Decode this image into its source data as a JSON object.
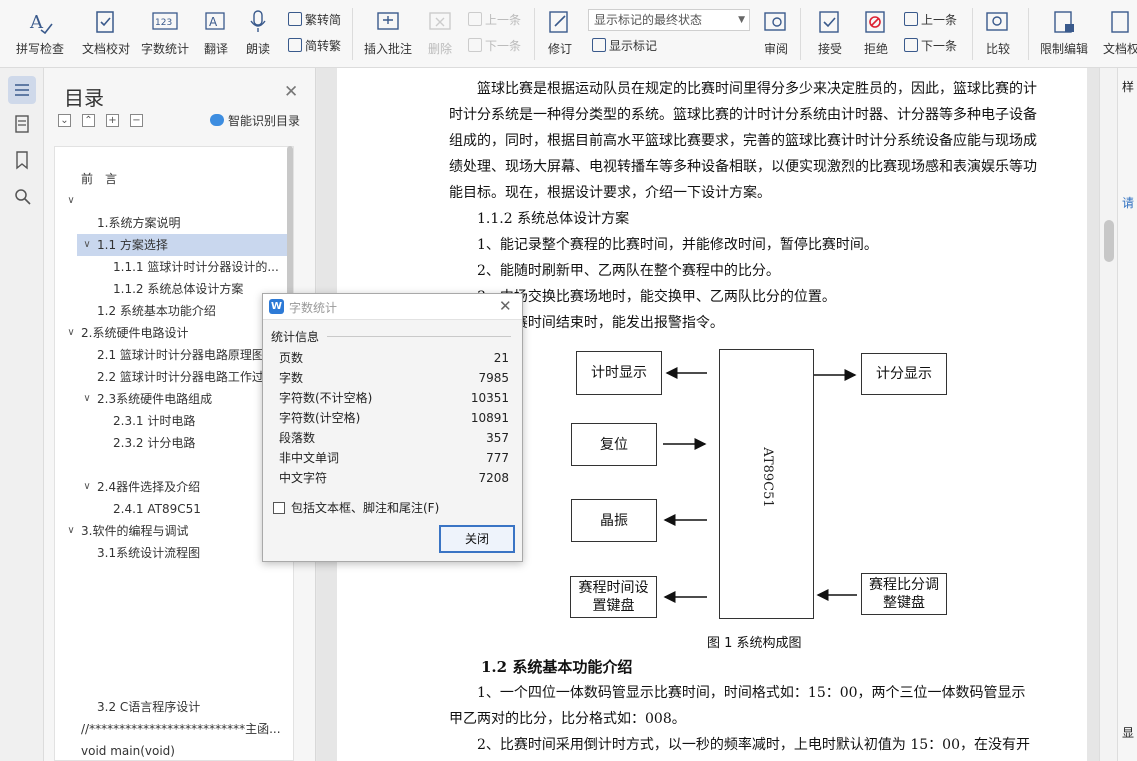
{
  "toolbar": {
    "spell_check": "拼写检查",
    "proofread": "文档校对",
    "word_count": "字数统计",
    "translate": "翻译",
    "read_aloud": "朗读",
    "trad_convert": "繁转简",
    "simp_convert": "简转繁",
    "insert_comment": "插入批注",
    "delete": "删除",
    "prev_comment": "上一条",
    "next_comment": "下一条",
    "revise": "修订",
    "mark_state": "显示标记的最终状态",
    "show_marks": "显示标记",
    "review": "审阅",
    "accept": "接受",
    "reject": "拒绝",
    "prev_change": "上一条",
    "next_change": "下一条",
    "compare": "比较",
    "restrict_edit": "限制编辑",
    "doc_permission": "文档权"
  },
  "toc": {
    "title": "目录",
    "smart_button": "智能识别目录",
    "items": [
      {
        "label": "前　言"
      },
      {
        "label": "1.系统方案说明"
      },
      {
        "label": "1.1  方案选择"
      },
      {
        "label": "1.1.1  篮球计时计分器设计的..."
      },
      {
        "label": "1.1.2  系统总体设计方案"
      },
      {
        "label": "1.2  系统基本功能介绍"
      },
      {
        "label": "2.系统硬件电路设计"
      },
      {
        "label": "2.1  篮球计时计分器电路原理图"
      },
      {
        "label": "2.2  篮球计时计分器电路工作过"
      },
      {
        "label": "2.3系统硬件电路组成"
      },
      {
        "label": "2.3.1  计时电路"
      },
      {
        "label": "2.3.2  计分电路"
      },
      {
        "label": "2.4器件选择及介绍"
      },
      {
        "label": "2.4.1  AT89C51"
      },
      {
        "label": "3.软件的编程与调试"
      },
      {
        "label": "3.1系统设计流程图"
      },
      {
        "label": "3.2 C语言程序设计"
      },
      {
        "label": "//**************************主函..."
      },
      {
        "label": "void main(void)"
      }
    ]
  },
  "doc": {
    "p1": "　　篮球比赛是根据运动队员在规定的比赛时间里得分多少来决定胜员的，因此，篮球比赛的计时计分系统是一种得分类型的系统。篮球比赛的计时计分系统由计时器、计分器等多种电子设备组成的，同时，根据目前高水平篮球比赛要求，完善的篮球比赛计时计分系统设备应能与现场成绩处理、现场大屏幕、电视转播车等多种设备相联，以便实现激烈的比赛现场感和表演娱乐等功能目标。现在，根据设计要求，介绍一下设计方案。",
    "h112": "　　1.1.2  系统总体设计方案",
    "l1": "　　1、能记录整个赛程的比赛时间，并能修改时间，暂停比赛时间。",
    "l2": "　　2、能随时刷新甲、乙两队在整个赛程中的比分。",
    "l3": "　　3、中场交换比赛场地时，能交换甲、乙两队比分的位置。",
    "l4": "　　4、比赛时间结束时，能发出报警指令。",
    "diagram": {
      "cpu": "AT89C51",
      "time_display": "计时显示",
      "score_display": "计分显示",
      "reset": "复位",
      "crystal": "晶振",
      "time_keys": "赛程时间设置键盘",
      "score_keys": "赛程比分调整键盘"
    },
    "figure_caption": "图 1 系统构成图",
    "section_title": "1.2  系统基本功能介绍",
    "p2": "　　1、一个四位一体数码管显示比赛时间，时间格式如：15：00，两个三位一体数码管显示甲乙两对的比分，比分格式如：008。",
    "p3": "　　2、比赛时间采用倒计时方式，以一秒的频率减时，上电时默认初值为 15：00，在没有开始"
  },
  "dialog": {
    "title": "字数统计",
    "group_label": "统计信息",
    "stats": [
      {
        "label": "页数",
        "value": "21"
      },
      {
        "label": "字数",
        "value": "7985"
      },
      {
        "label": "字符数(不计空格)",
        "value": "10351"
      },
      {
        "label": "字符数(计空格)",
        "value": "10891"
      },
      {
        "label": "段落数",
        "value": "357"
      },
      {
        "label": "非中文单词",
        "value": "777"
      },
      {
        "label": "中文字符",
        "value": "7208"
      }
    ],
    "include_label": "包括文本框、脚注和尾注(F)",
    "close_button": "关闭"
  },
  "right_panel": {
    "partial_labels": [
      "样",
      "请",
      "显"
    ]
  }
}
